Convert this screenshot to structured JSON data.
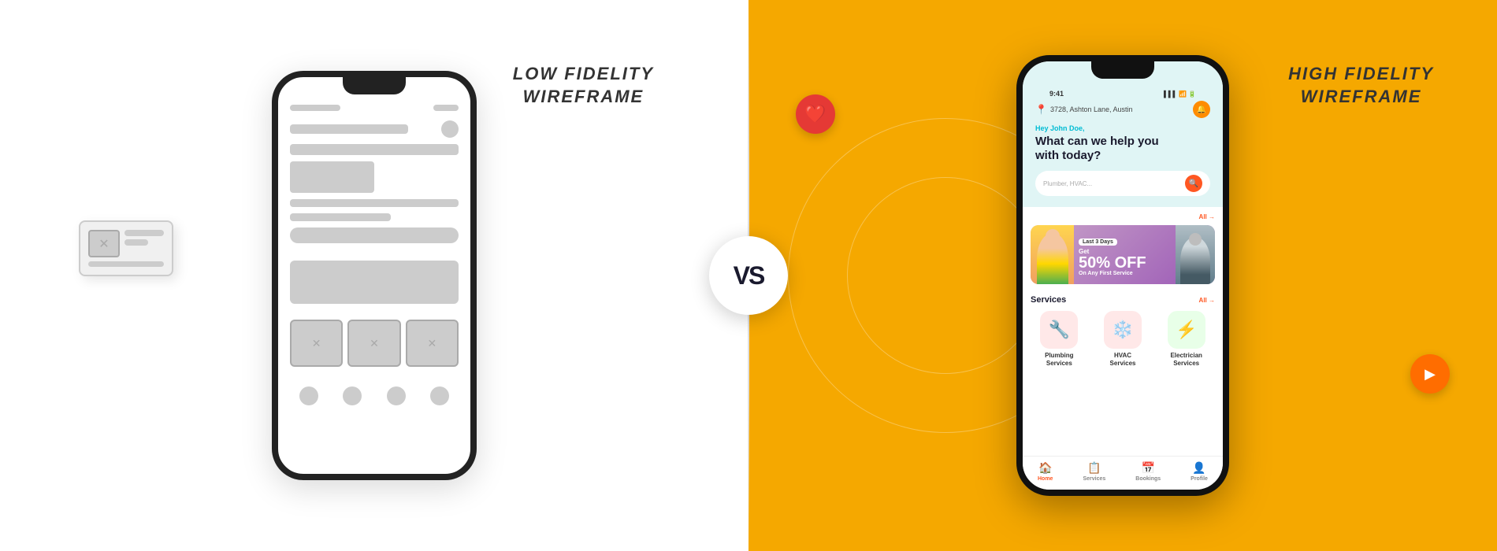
{
  "left": {
    "label_line1": "LOW FIDELITY",
    "label_line2": "WIREFRAME"
  },
  "right": {
    "label_line1": "HIGH FIDELITY",
    "label_line2": "WIREFRAME"
  },
  "vs": "VS",
  "app": {
    "status_time": "9:41",
    "location": "3728, Ashton Lane, Austin",
    "greeting": "Hey John Doe,",
    "tagline_line1": "What can we help you",
    "tagline_line2": "with today?",
    "search_placeholder": "Plumber, HVAC...",
    "promo_badge": "Last 3 Days",
    "promo_get": "Get",
    "promo_percent": "50% OFF",
    "promo_sub": "On Any First Service",
    "all_label": "All →",
    "services_title": "Services",
    "services_all": "All →",
    "services": [
      {
        "icon": "🔧",
        "label": "Plumbing\nServices",
        "bg": "#FFE0E0"
      },
      {
        "icon": "❄️",
        "label": "HVAC\nServices",
        "bg": "#FFE0E0"
      },
      {
        "icon": "⚡",
        "label": "Electrician\nServices",
        "bg": "#E0FFE0"
      }
    ],
    "nav_items": [
      {
        "icon": "🏠",
        "label": "Home",
        "active": true
      },
      {
        "icon": "📋",
        "label": "Services",
        "active": false
      },
      {
        "icon": "📅",
        "label": "Bookings",
        "active": false
      },
      {
        "icon": "👤",
        "label": "Profile",
        "active": false
      }
    ]
  }
}
